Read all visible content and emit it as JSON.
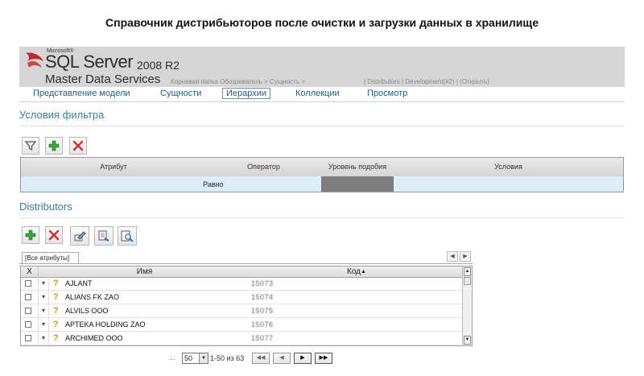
{
  "caption": "Справочник дистрибьюторов после очистки и загрузки данных в хранилище",
  "header": {
    "microsoft": "Microsoft®",
    "product": "SQL Server",
    "version": "2008 R2",
    "service": "Master Data Services",
    "breadcrumb": "Корневая папка  Обозреватель > Сущность >",
    "model_info": "| Distributors | Development(#2) | (Открыть)"
  },
  "nav": {
    "items": [
      {
        "label": "Представление модели"
      },
      {
        "label": "Сущности"
      },
      {
        "label": "Иерархии"
      },
      {
        "label": "Коллекции"
      },
      {
        "label": "Просмотр"
      }
    ]
  },
  "filter": {
    "title": "Условия фильтра",
    "toolbar": {
      "filter_icon": "funnel-icon",
      "add_icon": "plus-icon",
      "delete_icon": "x-icon"
    },
    "columns": {
      "attribute": "Атрибут",
      "operator": "Оператор",
      "similarity": "Уровень подобия",
      "conditions": "Условия"
    },
    "row": {
      "attribute": "",
      "operator": "Равно",
      "similarity": "",
      "conditions": ""
    }
  },
  "entity": {
    "title": "Distributors",
    "toolbar": [
      "plus-icon",
      "x-icon",
      "edit-icon",
      "export-icon",
      "zoom-icon"
    ],
    "tab_label": "[Все атрибуты]",
    "columns": {
      "select": "X",
      "name": "Имя",
      "code": "Код"
    },
    "rows": [
      {
        "name": "AJLANT",
        "code": "15073"
      },
      {
        "name": "ALIANS FK ZAO",
        "code": "15074"
      },
      {
        "name": "ALVILS OOO",
        "code": "15075"
      },
      {
        "name": "APTEKA HOLDING ZAO",
        "code": "15076"
      },
      {
        "name": "ARCHIMED OOO",
        "code": "15077"
      }
    ]
  },
  "pager": {
    "ellipsis": "...",
    "page_size": "50",
    "range": "1-50 из 63",
    "buttons": [
      "◀◀",
      "◀",
      "▶",
      "▶▶"
    ]
  },
  "colors": {
    "accent": "#3a7f95",
    "nav_link": "#1f5f8b",
    "header_bg": "#d6d6d6",
    "filter_row": "#dcedfb"
  }
}
